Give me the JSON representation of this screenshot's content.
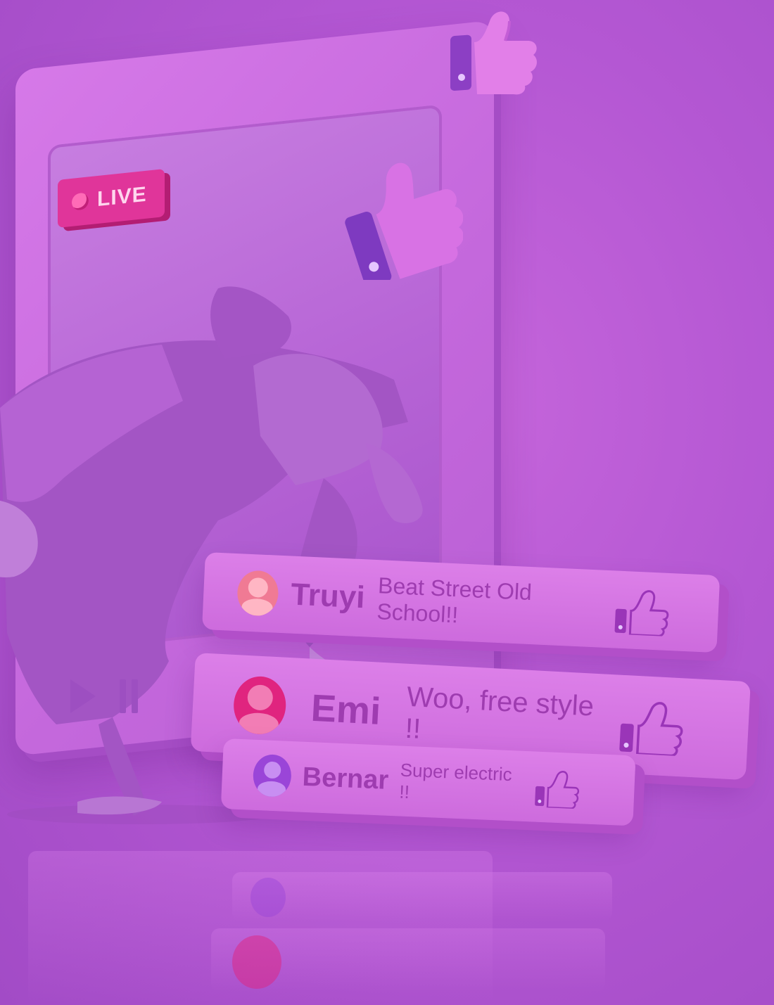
{
  "scene": {
    "live_badge": {
      "label": "LIVE"
    },
    "colors": {
      "background": "#b457d3",
      "frame": "#c468dc",
      "live_badge": "#e0359a",
      "accent_text": "#9e3cb0"
    }
  },
  "comments": [
    {
      "name": "Truyi",
      "text": "Beat Street Old School!!",
      "avatar_color": "#f07a94",
      "icon": "thumbs-up-icon"
    },
    {
      "name": "Emi",
      "text": "Woo, free style !!",
      "avatar_color": "#e0247f",
      "icon": "thumbs-up-icon"
    },
    {
      "name": "Bernar",
      "text": "Super electric !!",
      "avatar_color": "#9a45d8",
      "icon": "thumbs-up-icon"
    }
  ],
  "controls": {
    "icons": [
      "play-icon",
      "pause-icon"
    ]
  },
  "decorations": {
    "floating_icons": [
      "thumbs-up-icon",
      "thumbs-up-icon"
    ]
  }
}
